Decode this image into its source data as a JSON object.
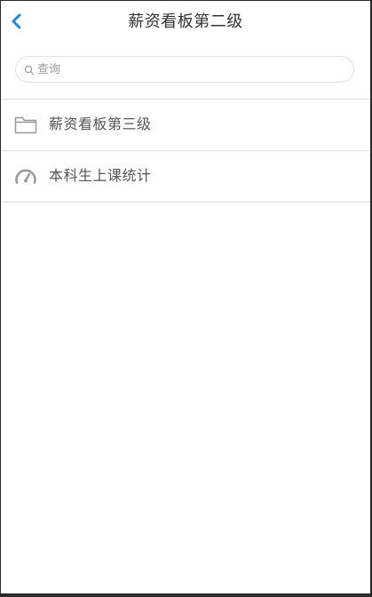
{
  "header": {
    "title": "薪资看板第二级",
    "back_icon": "chevron-left-icon"
  },
  "search": {
    "placeholder": "查询",
    "value": "",
    "icon": "search-icon"
  },
  "list": {
    "items": [
      {
        "label": "薪资看板第三级",
        "icon": "folder-icon"
      },
      {
        "label": "本科生上课统计",
        "icon": "gauge-icon"
      }
    ]
  },
  "colors": {
    "accent": "#1a8be0",
    "icon_gray": "#999999",
    "divider": "#dcdcdc"
  }
}
